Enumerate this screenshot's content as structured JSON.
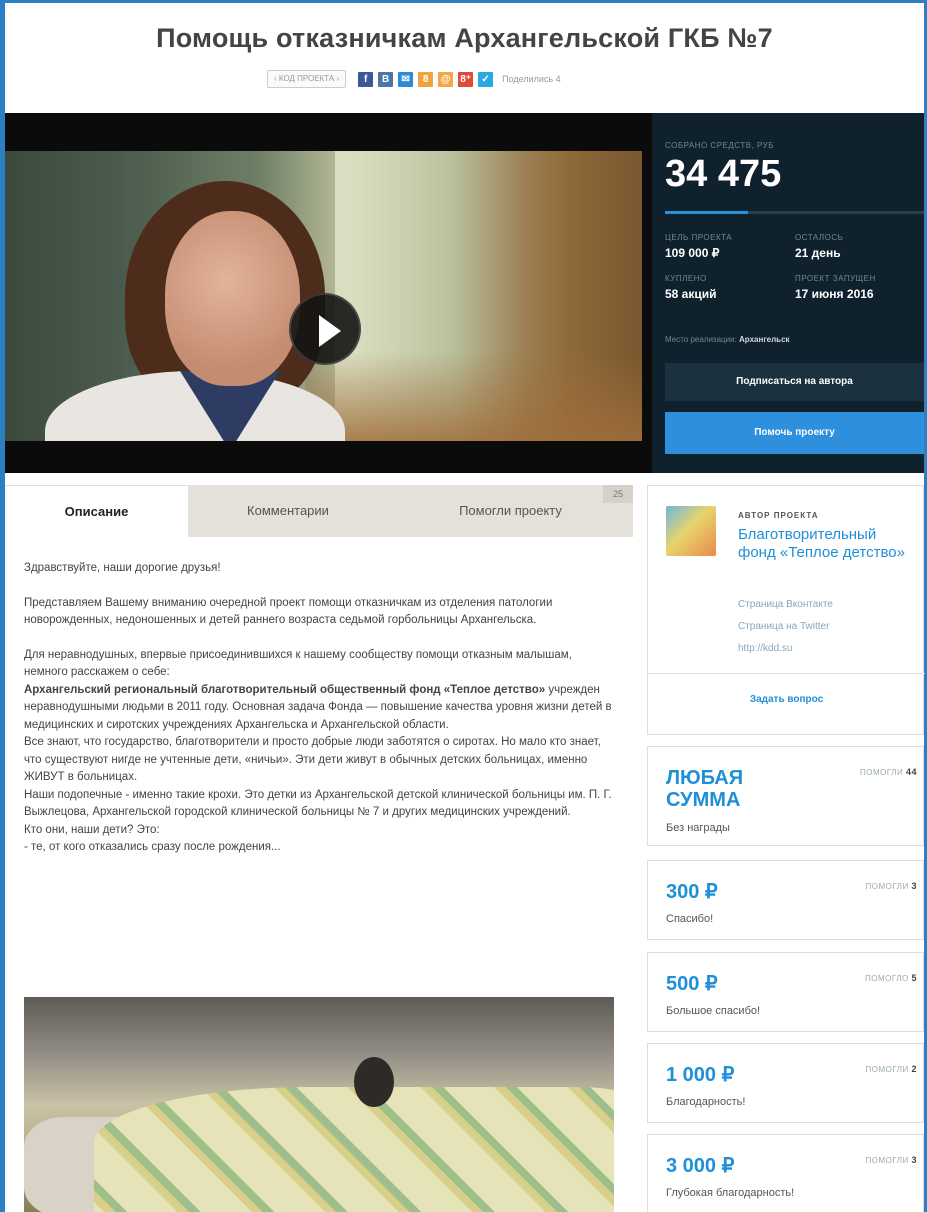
{
  "project": {
    "title": "Помощь отказничкам Архангельской ГКБ №7",
    "code_button": "‹ КОД ПРОЕКТА ›",
    "share_label": "Поделились 4",
    "social": [
      {
        "icon": "f",
        "name": "facebook",
        "color": "#3b5998"
      },
      {
        "icon": "В",
        "name": "vkontakte",
        "color": "#4a76a8"
      },
      {
        "icon": "✉",
        "name": "mail",
        "color": "#2f8ad6"
      },
      {
        "icon": "8",
        "name": "odnoklassniki",
        "color": "#f2a23a"
      },
      {
        "icon": "@",
        "name": "mailru",
        "color": "#f4a74a"
      },
      {
        "icon": "8⁺",
        "name": "googleplus",
        "color": "#dd4b39"
      },
      {
        "icon": "✓",
        "name": "twitter",
        "color": "#29a9e1"
      }
    ]
  },
  "stats": {
    "raised_label": "СОБРАНО СРЕДСТВ, РУБ",
    "raised_value": "34 475",
    "progress": 0.32,
    "goal_label": "ЦЕЛЬ ПРОЕКТА",
    "goal_value": "109 000 ₽",
    "left_label": "ОСТАЛОСЬ",
    "left_value": "21 день",
    "bought_label": "КУПЛЕНО",
    "bought_value": "58 акций",
    "started_label": "ПРОЕКТ ЗАПУЩЕН",
    "started_value": "17 июня 2016",
    "place_label": "Место реализации:",
    "place_value": "Архангельск",
    "subscribe_label": "Подписаться на автора",
    "help_label": "Помочь проекту"
  },
  "tabs": {
    "description": "Описание",
    "comments": "Комментарии",
    "helped": "Помогли проекту",
    "helped_count": "25"
  },
  "description": {
    "greeting": "Здравствуйте, наши дорогие друзья!",
    "intro": "Представляем Вашему вниманию очередной проект помощи отказничкам из отделения патологии новорожденных, недоношенных и детей раннего возраста седьмой горбольницы Архангельска.",
    "newcomers": "Для неравнодушных, впервые присоединившихся к нашему сообществу помощи отказным малышам, немного расскажем о себе:",
    "fund_bold": "Архангельский региональный благотворительный общественный фонд «Теплое детство»",
    "fund_rest": " учрежден неравнодушными людьми в 2011 году. Основная задача Фонда — повышение качества уровня жизни детей в медицинских и сиротских учреждениях Архангельска и Архангельской области.",
    "everyone_knows": "Все знают, что государство, благотворители и просто добрые люди заботятся о сиротах. Но мало кто знает, что существуют нигде не учтенные дети, «ничьи». Эти дети живут в обычных детских больницах, именно ЖИВУТ в больницах.",
    "our_wards": "Наши подопечные - именно такие крохи. Это детки из Архангельской детской клинической больницы им. П. Г. Выжлецова, Архангельской городской клинической больницы № 7 и других медицинских учреждений.",
    "who": "Кто они, наши дети? Это:",
    "first": "- те, от кого отказались сразу после рождения..."
  },
  "author": {
    "label": "АВТОР ПРОЕКТА",
    "name": "Благотворительный фонд «Теплое детство»",
    "vk": "Страница Вконтакте",
    "twitter": "Страница на Twitter",
    "site": "http://kdd.su",
    "ask": "Задать вопрос"
  },
  "rewards": [
    {
      "amount": "ЛЮБАЯ СУММА",
      "helped_label": "ПОМОГЛИ",
      "helped_count": "44",
      "text": "Без награды"
    },
    {
      "amount": "300 ₽",
      "helped_label": "ПОМОГЛИ",
      "helped_count": "3",
      "text": "Спасибо!"
    },
    {
      "amount": "500 ₽",
      "helped_label": "ПОМОГЛО",
      "helped_count": "5",
      "text": "Большое спасибо!"
    },
    {
      "amount": "1 000 ₽",
      "helped_label": "ПОМОГЛИ",
      "helped_count": "2",
      "text": "Благодарность!"
    },
    {
      "amount": "3 000 ₽",
      "helped_label": "ПОМОГЛИ",
      "helped_count": "3",
      "text": "Глубокая благодарность!"
    }
  ]
}
